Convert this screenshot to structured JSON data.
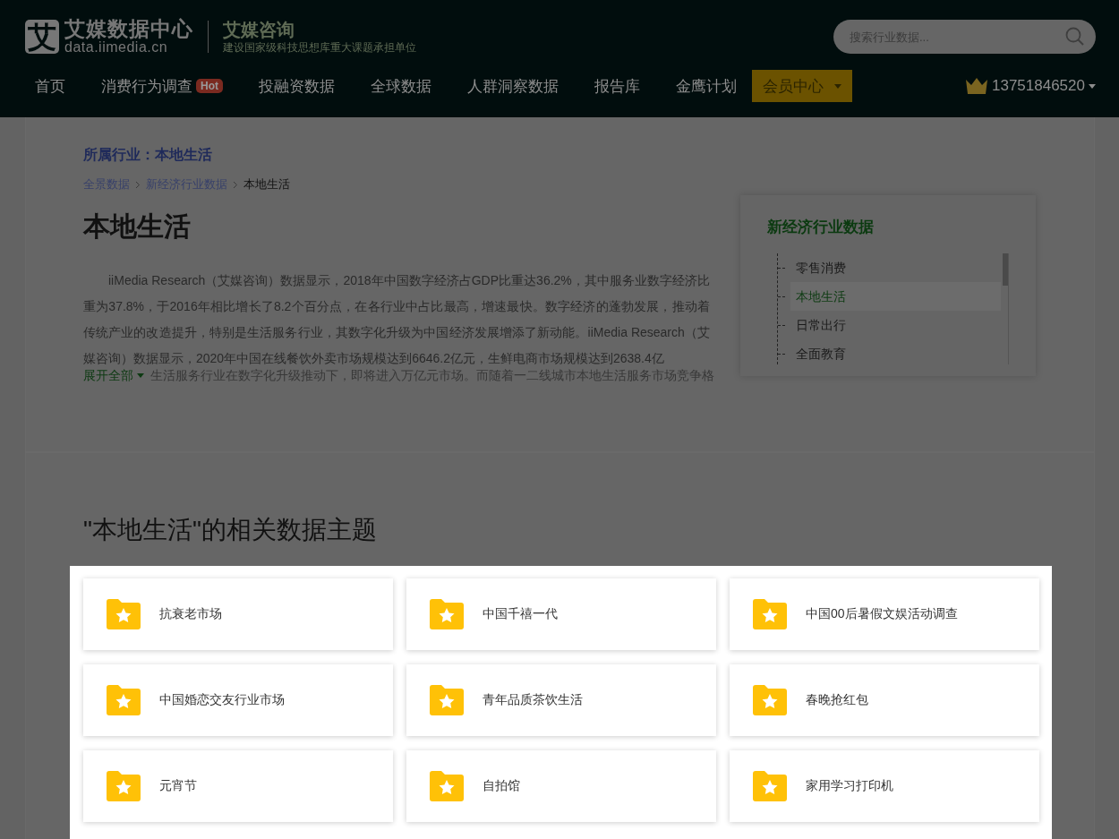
{
  "header": {
    "logo": {
      "mark": "艾",
      "title": "艾媒数据中心",
      "url": "data.iimedia.cn"
    },
    "brand": {
      "name": "艾媒咨询",
      "tagline": "建设国家级科技思想库重大课题承担单位"
    },
    "search": {
      "placeholder": "搜索行业数据..."
    },
    "nav": [
      {
        "kind": "link",
        "label": "首页"
      },
      {
        "kind": "link",
        "label": "消费行为调查",
        "badge": "Hot"
      },
      {
        "kind": "link",
        "label": "投融资数据"
      },
      {
        "kind": "link",
        "label": "全球数据"
      },
      {
        "kind": "link",
        "label": "人群洞察数据"
      },
      {
        "kind": "link",
        "label": "报告库"
      },
      {
        "kind": "link",
        "label": "金鹰计划"
      },
      {
        "kind": "button",
        "label": "会员中心"
      }
    ],
    "account": {
      "phone": "13751846520"
    }
  },
  "industry": {
    "label": "所属行业：本地生活",
    "breadcrumb": [
      {
        "label": "全景数据",
        "link": true
      },
      {
        "label": "新经济行业数据",
        "link": true
      },
      {
        "label": "本地生活",
        "link": false
      }
    ],
    "title": "本地生活",
    "description": "iiMedia Research（艾媒咨询）数据显示，2018年中国数字经济占GDP比重达36.2%，其中服务业数字经济比重为37.8%，于2016年相比增长了8.2个百分点，在各行业中占比最高，增速最快。数字经济的蓬勃发展，推动着传统产业的改造提升，特别是生活服务行业，其数字化升级为中国经济发展增添了新动能。iiMedia Research（艾媒咨询）数据显示，2020年中国在线餐饮外卖市场规模达到6646.2亿元，生鲜电商市场规模达到2638.4亿",
    "faded_line": "生活服务行业在数字化升级推动下，即将进入万亿元市场。而随着一二线城市本地生活服务市场竞争格",
    "expand": "展开全部"
  },
  "sidebar": {
    "title": "新经济行业数据",
    "items": [
      {
        "label": "零售消费",
        "selected": false
      },
      {
        "label": "本地生活",
        "selected": true
      },
      {
        "label": "日常出行",
        "selected": false
      },
      {
        "label": "全面教育",
        "selected": false
      }
    ]
  },
  "topics": {
    "title": "\"本地生活\"的相关数据主题",
    "items": [
      {
        "label": "抗衰老市场"
      },
      {
        "label": "中国千禧一代"
      },
      {
        "label": "中国00后暑假文娱活动调查"
      },
      {
        "label": "中国婚恋交友行业市场"
      },
      {
        "label": "青年品质茶饮生活"
      },
      {
        "label": "春晚抢红包"
      },
      {
        "label": "元宵节"
      },
      {
        "label": "自拍馆"
      },
      {
        "label": "家用学习打印机"
      }
    ]
  }
}
